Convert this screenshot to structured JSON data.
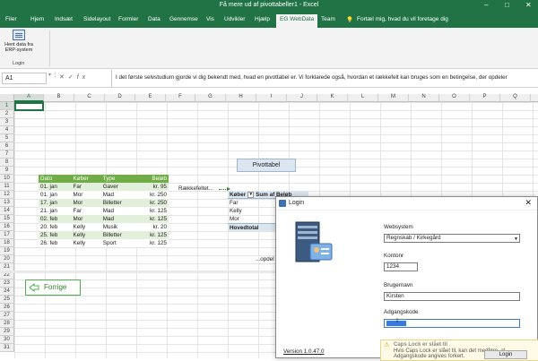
{
  "window": {
    "title": "Få mere ud af pivottabeller1 - Excel",
    "controls": [
      "–",
      "□",
      "✕"
    ]
  },
  "tabs": [
    "Filer",
    "Hjem",
    "Indsæt",
    "Sidelayout",
    "Formler",
    "Data",
    "Gennemse",
    "Vis",
    "Udvikler",
    "Hjælp",
    "EG WebData",
    "Team"
  ],
  "tell_me": "Fortæl mig, hvad du vil foretage dig",
  "ribbon": {
    "button_label": "Hent data fra ERP-system",
    "group_label": "Login"
  },
  "formula_bar": {
    "name_box": "A1",
    "formula": "I det første selvstudium gjorde vi dig bekendt med, hvad en pivottabel er. Vi forklarede også, hvordan et rækkefelt kan bruges som en betingelse, der opdeler"
  },
  "columns": [
    "A",
    "B",
    "C",
    "D",
    "E",
    "F",
    "G",
    "H",
    "I",
    "J",
    "K",
    "L",
    "M",
    "N",
    "O",
    "P",
    "Q",
    "R"
  ],
  "rows": [
    "1",
    "2",
    "3",
    "4",
    "5",
    "6",
    "7",
    "8",
    "9",
    "10",
    "11",
    "12",
    "13",
    "14",
    "15",
    "16",
    "17",
    "18",
    "19",
    "20",
    "21",
    "22",
    "23",
    "24",
    "25",
    "26",
    "27",
    "28",
    "29",
    "30",
    "31"
  ],
  "data_table": {
    "headers": [
      "Dato",
      "Køber",
      "Type",
      "Beløb"
    ],
    "rows": [
      [
        "01. jan",
        "Far",
        "Gaver",
        "kr. 95"
      ],
      [
        "01. jan",
        "Mor",
        "Mad",
        "kr. 250"
      ],
      [
        "17. jan",
        "Mor",
        "Billetter",
        "kr. 250"
      ],
      [
        "21. jan",
        "Far",
        "Mad",
        "kr. 125"
      ],
      [
        "02. feb",
        "Mor",
        "Mad",
        "kr. 125"
      ],
      [
        "20. feb",
        "Kelly",
        "Musik",
        "kr. 20"
      ],
      [
        "25. feb",
        "Kelly",
        "Billetter",
        "kr. 125"
      ],
      [
        "26. feb",
        "Kelly",
        "Sport",
        "kr. 125"
      ]
    ]
  },
  "pivot": {
    "label": "Pivottabel",
    "row_field_caption": "Rækkefeltet...",
    "header_col1": "Køber",
    "header_col2": "Sum af Beløb",
    "items": [
      "Far",
      "Kelly",
      "Mor"
    ],
    "total": "Hovedtotal",
    "footer": "...opdel"
  },
  "forrige_button": "Forrige",
  "login": {
    "title": "Login",
    "websystem_label": "Websystem",
    "websystem_value": "Regnskab / Kirkegård",
    "kontonr_label": "Kontonr",
    "kontonr_value": "1234",
    "brugernavn_label": "Brugernavn",
    "brugernavn_value": "Kirsten",
    "adgangskode_label": "Adgangskode",
    "version": "Version 1.0.47.0",
    "caps_title": "Caps Lock er slået til",
    "caps_text": "Hvis Caps Lock er slået til, kan det medføre, at Adgangskode angives forkert.",
    "login_button": "Login"
  },
  "colors": {
    "excel_green": "#217346",
    "table_header": "#70ad47",
    "table_band": "#e2efda",
    "pivot_band": "#dce6f1"
  }
}
